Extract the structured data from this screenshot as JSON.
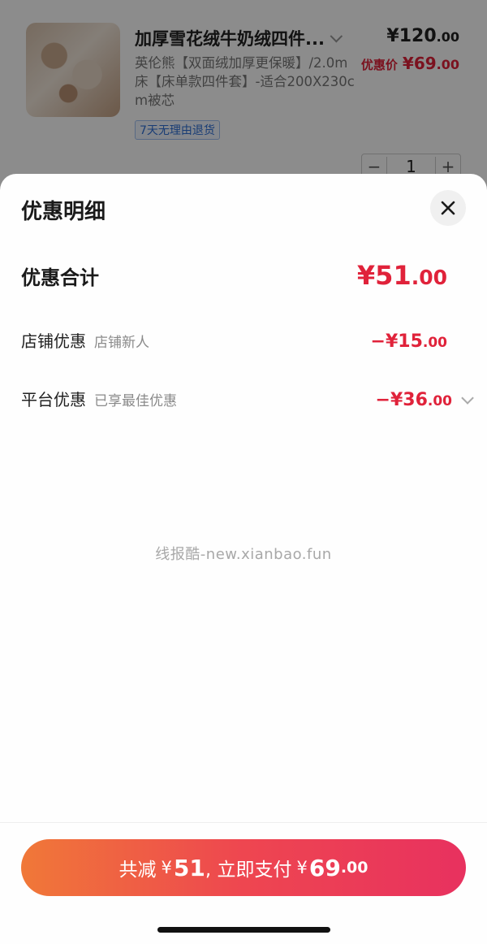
{
  "product": {
    "title": "加厚雪花绒牛奶绒四件...",
    "spec": "英伦熊【双面绒加厚更保暖】/2.0m床【床单款四件套】-适合200X230cm被芯",
    "original_price": "¥120",
    "original_price_decimal": ".00",
    "sale_label": "优惠价",
    "sale_price": "¥69",
    "sale_price_decimal": ".00",
    "return_badge": "7天无理由退货",
    "quantity": "1",
    "minus": "−",
    "plus": "+"
  },
  "sheet": {
    "title": "优惠明细",
    "total_label": "优惠合计",
    "total_amount": "¥51",
    "total_amount_decimal": ".00",
    "rows": [
      {
        "label": "店铺优惠",
        "sub": "店铺新人",
        "amount": "−¥15",
        "amount_decimal": ".00"
      },
      {
        "label": "平台优惠",
        "sub": "已享最佳优惠",
        "amount": "−¥36",
        "amount_decimal": ".00"
      }
    ],
    "watermark": "线报酷-new.xianbao.fun"
  },
  "pay": {
    "prefix": "共减",
    "discount_symbol": "¥",
    "discount": "51",
    "middle": ", 立即支付",
    "pay_symbol": "¥",
    "pay_amount": "69",
    "pay_decimal": ".00"
  },
  "colors": {
    "accent_red": "#e0223a",
    "button_gradient_start": "#f07838",
    "button_gradient_end": "#e8315f",
    "badge_blue": "#2f6fd6"
  },
  "icons": {
    "close": "close-icon",
    "title_chevron": "chevron-down-icon",
    "platform_chevron": "chevron-down-icon"
  }
}
